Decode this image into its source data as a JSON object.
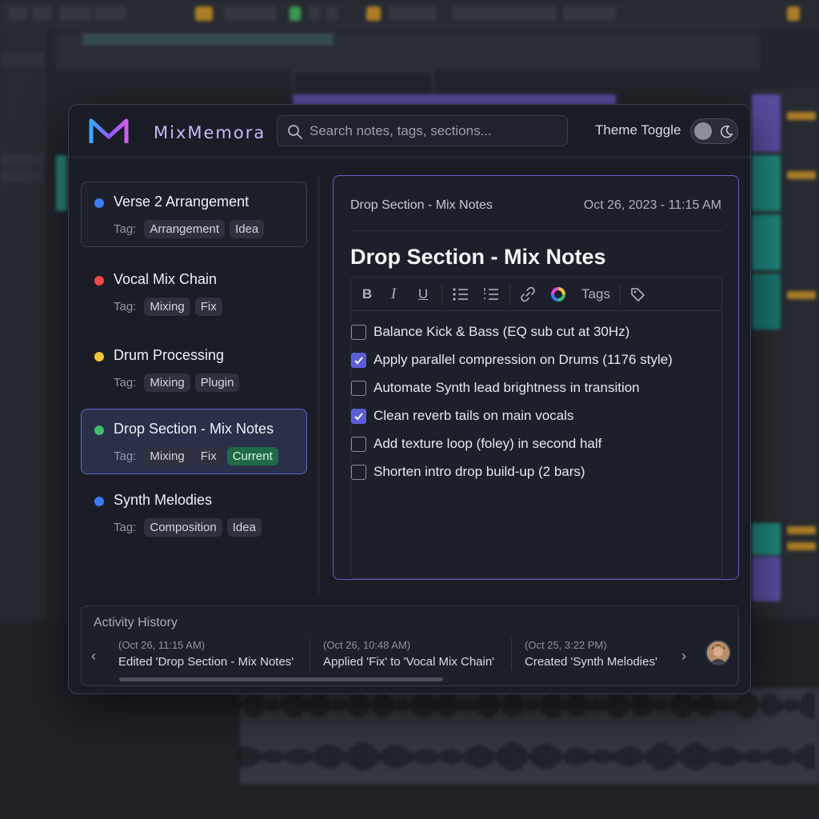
{
  "app": {
    "logo_text": "MixMemora",
    "search_placeholder": "Search notes, tags, sections...",
    "theme_toggle_label": "Theme Toggle"
  },
  "notes": [
    {
      "title": "Verse 2 Arrangement",
      "tag_label": "Tag:",
      "tags": [
        "Arrangement",
        "Idea"
      ],
      "dot_color": "#3d7bf2"
    },
    {
      "title": "Vocal Mix Chain",
      "tag_label": "Tag:",
      "tags": [
        "Mixing",
        "Fix"
      ],
      "dot_color": "#ef4a4a"
    },
    {
      "title": "Drum Processing",
      "tag_label": "Tag:",
      "tags": [
        "Mixing",
        "Plugin"
      ],
      "dot_color": "#f3c53a"
    },
    {
      "title": "Drop Section - Mix Notes",
      "tag_label": "Tag:",
      "tags": [
        "Mixing",
        "Fix",
        "Current"
      ],
      "dot_color": "#3fbf6a"
    },
    {
      "title": "Synth Melodies",
      "tag_label": "Tag:",
      "tags": [
        "Composition",
        "Idea"
      ],
      "dot_color": "#3d7bf2"
    }
  ],
  "editor": {
    "note_name": "Drop Section - Mix Notes",
    "date": "Oct 26, 2023 - 11:15 AM",
    "title": "Drop Section - Mix Notes",
    "toolbar": {
      "bold": "B",
      "italic": "I",
      "underline": "U",
      "tags_label": "Tags"
    },
    "checklist": [
      {
        "text": "Balance Kick & Bass (EQ sub cut at 30Hz)",
        "checked": false
      },
      {
        "text": "Apply parallel compression on Drums (1176 style)",
        "checked": true
      },
      {
        "text": "Automate Synth lead brightness in transition",
        "checked": false
      },
      {
        "text": "Clean reverb tails on main vocals",
        "checked": true
      },
      {
        "text": "Add texture loop (foley) in second half",
        "checked": false
      },
      {
        "text": "Shorten intro drop build-up (2 bars)",
        "checked": false
      }
    ]
  },
  "activity": {
    "title": "Activity History",
    "items": [
      {
        "time": "(Oct 26, 11:15 AM)",
        "desc": "Edited 'Drop Section - Mix Notes'"
      },
      {
        "time": "(Oct 26, 10:48 AM)",
        "desc": "Applied 'Fix' to 'Vocal Mix Chain'"
      },
      {
        "time": "(Oct 25, 3:22 PM)",
        "desc": "Created 'Synth Melodies'"
      }
    ],
    "prev_arrow": "‹",
    "next_arrow": "›"
  },
  "colors": {
    "accent": "#5b5fd6",
    "current_tag": "#1e6b45"
  }
}
